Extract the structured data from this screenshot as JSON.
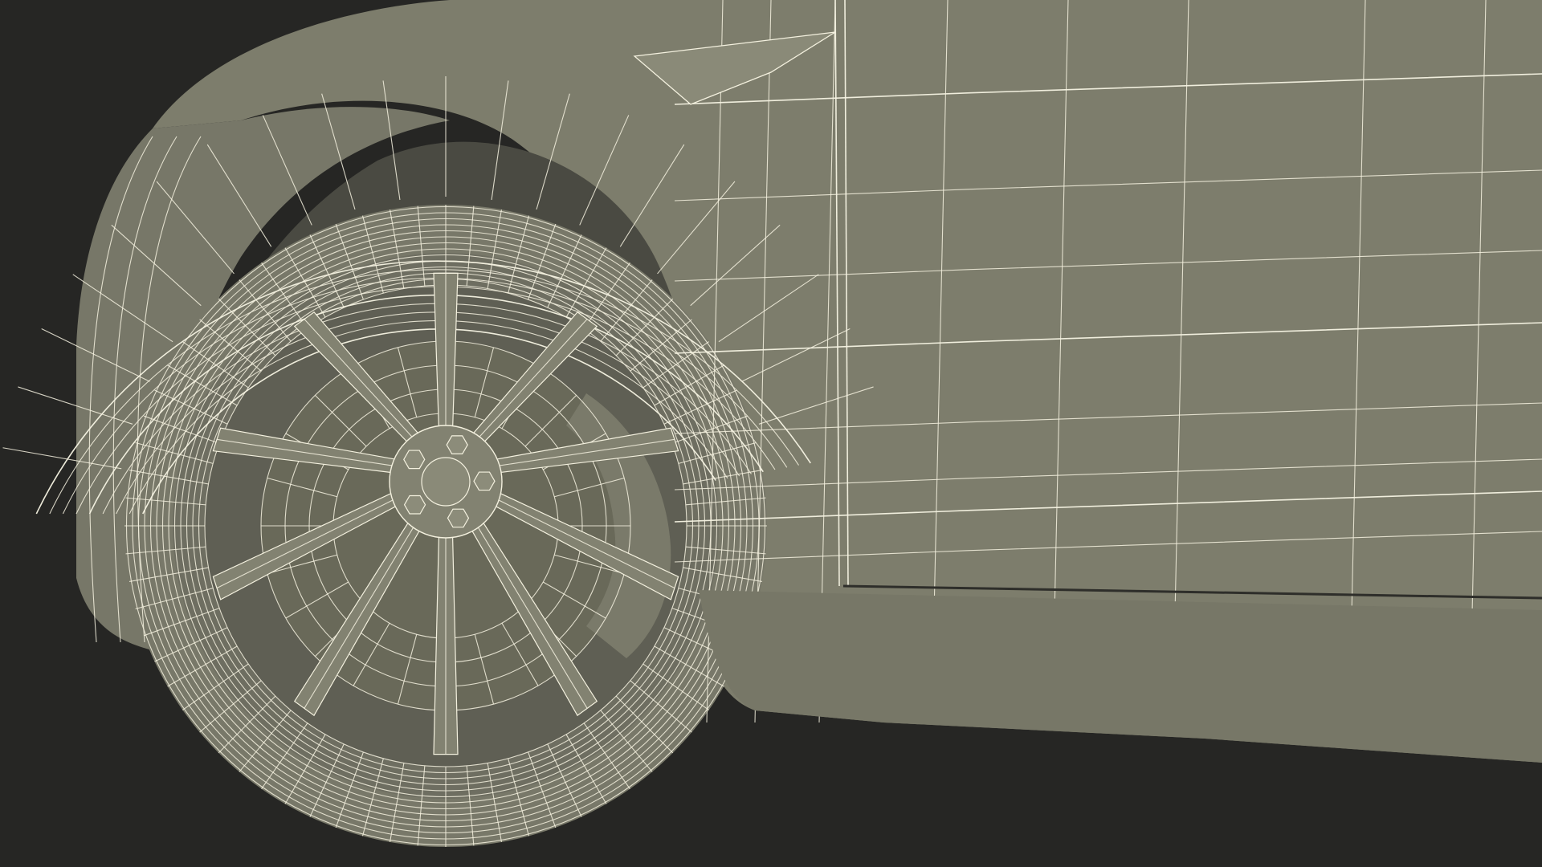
{
  "scene": {
    "subject": "car-front-wheel-wireframe",
    "render_style": "wireframe-over-shaded",
    "colors": {
      "background": "#262624",
      "body_shade": "#7e7e6d",
      "body_shade_dark": "#6c6c5d",
      "tire_shade": "#76766a",
      "wheel_well_dark": "#4a4a42",
      "wire": "#f4f1df"
    },
    "wheel": {
      "spoke_count": 10,
      "lug_nut_count": 5
    }
  }
}
